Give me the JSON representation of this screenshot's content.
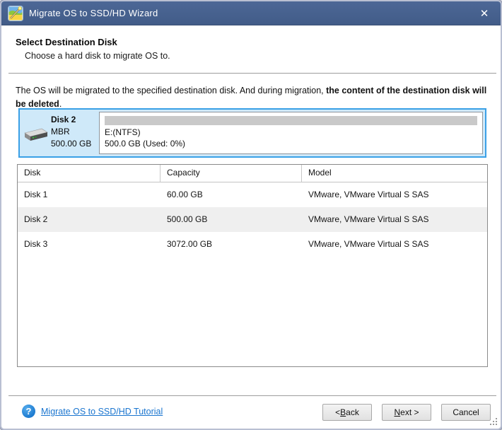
{
  "window": {
    "title": "Migrate OS to SSD/HD Wizard",
    "icons": {
      "titlebar_icon": "wizard-wand-icon",
      "close_glyph": "✕",
      "help_glyph": "?"
    }
  },
  "header": {
    "title": "Select Destination Disk",
    "subtitle": "Choose a hard disk to migrate OS to."
  },
  "warning": {
    "normal": "The OS will be migrated to the specified destination disk. And during migration, ",
    "bold": "the content of the destination disk will be deleted",
    "suffix": "."
  },
  "selected_disk": {
    "name": "Disk 2",
    "partition_style": "MBR",
    "size": "500.00 GB",
    "partition": {
      "label": "E:(NTFS)",
      "detail": "500.0 GB (Used: 0%)"
    }
  },
  "disk_table": {
    "columns": [
      "Disk",
      "Capacity",
      "Model"
    ],
    "rows": [
      {
        "disk": "Disk 1",
        "capacity": "60.00 GB",
        "model": "VMware, VMware Virtual S SAS",
        "selected": false
      },
      {
        "disk": "Disk 2",
        "capacity": "500.00 GB",
        "model": "VMware, VMware Virtual S SAS",
        "selected": true
      },
      {
        "disk": "Disk 3",
        "capacity": "3072.00 GB",
        "model": "VMware, VMware Virtual S SAS",
        "selected": false
      }
    ]
  },
  "footer": {
    "tutorial_link": "Migrate OS to SSD/HD Tutorial",
    "buttons": [
      {
        "label": "< Back",
        "key": "B"
      },
      {
        "label": "Next >",
        "key": "N"
      },
      {
        "label": "Cancel",
        "key": ""
      }
    ]
  },
  "colors": {
    "titlebar": "#45608c",
    "panel_border": "#3aa0e6",
    "panel_background": "#cfe9f9",
    "partition_bar": "#c9c9c9",
    "selected_row": "#efefef",
    "link": "#1a75cf",
    "help_icon": "#2e8fe0",
    "button_face": "#e7e7e7"
  }
}
